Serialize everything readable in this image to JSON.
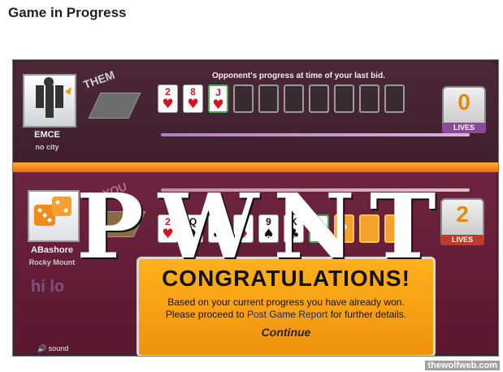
{
  "page": {
    "title": "Game in Progress"
  },
  "opponent": {
    "name": "EMCE",
    "city": "no city",
    "side_label": "THEM",
    "lives": "0",
    "lives_label": "LIVES",
    "progress_label": "Opponent's progress at time of your last bid."
  },
  "player": {
    "name": "ABashore",
    "city": "Rocky Mount",
    "side_label": "YOU",
    "lives": "2",
    "lives_label": "LIVES"
  },
  "opponent_cards": [
    {
      "rank": "2",
      "suit": "♥",
      "color": "red"
    },
    {
      "rank": "8",
      "suit": "♥",
      "color": "red"
    },
    {
      "rank": "J",
      "suit": "♥",
      "color": "red"
    }
  ],
  "player_cards": [
    {
      "rank": "2",
      "suit": "♥",
      "color": "red"
    },
    {
      "rank": "Q",
      "suit": "♠",
      "color": "black"
    },
    {
      "rank": "4",
      "suit": "♣",
      "color": "black"
    },
    {
      "rank": "4",
      "suit": "♦",
      "color": "red"
    },
    {
      "rank": "9",
      "suit": "♠",
      "color": "black"
    },
    {
      "rank": "K",
      "suit": "♣",
      "color": "black"
    },
    {
      "rank": "4",
      "suit": "♥",
      "color": "red"
    }
  ],
  "player_pending": "?",
  "congrats": {
    "title": "CONGRATULATIONS!",
    "line1": "Based on your current progress you have already won.",
    "line2_pre": "Please proceed to ",
    "line2_link": "Post Game Report",
    "line2_post": " for further details.",
    "continue": "Continue"
  },
  "sound_label": "sound",
  "overlay_text": "PWNT",
  "hilo_text": "hi lo",
  "watermark": "thewolfweb.com",
  "colors": {
    "accent": "#f0920c",
    "panel": "#5a1730",
    "top_panel": "#3e1f2d"
  }
}
